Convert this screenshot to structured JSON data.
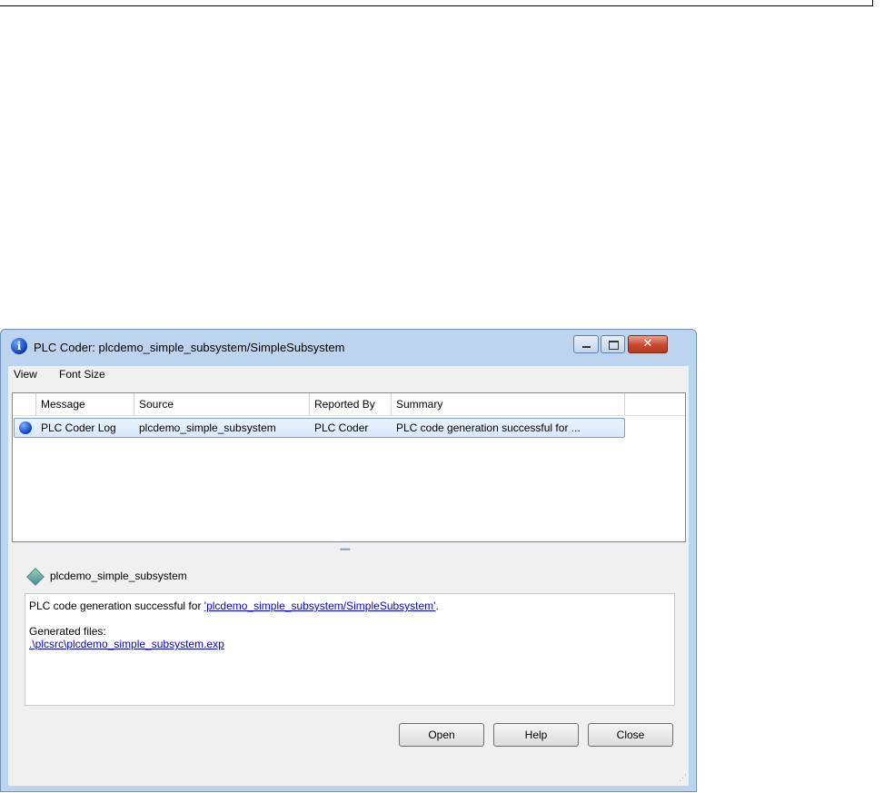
{
  "window": {
    "title": "PLC Coder: plcdemo_simple_subsystem/SimpleSubsystem",
    "title_icon": "info-icon",
    "close_glyph": "✕"
  },
  "menu": {
    "items": [
      "View",
      "Font Size"
    ]
  },
  "table": {
    "columns": [
      "Message",
      "Source",
      "Reported By",
      "Summary"
    ],
    "rows": [
      {
        "icon": "info-icon",
        "message": "PLC Coder Log",
        "source": "plcdemo_simple_subsystem",
        "reported_by": "PLC Coder",
        "summary": "PLC code generation successful for ..."
      }
    ]
  },
  "splitter": {
    "grip": "•••••"
  },
  "detail": {
    "name": "plcdemo_simple_subsystem",
    "icon": "model-diamond-icon",
    "text_prefix": "PLC code generation successful for ",
    "text_link": "'plcdemo_simple_subsystem/SimpleSubsystem'",
    "text_suffix": ".",
    "files_label": "Generated files:",
    "file_link": ".\\plcsrc\\plcdemo_simple_subsystem.exp"
  },
  "buttons": {
    "open": "Open",
    "help": "Help",
    "close": "Close"
  },
  "colors": {
    "frame": "#bdd4ee",
    "selection": "#d7e8fb",
    "link": "#0000ee"
  }
}
